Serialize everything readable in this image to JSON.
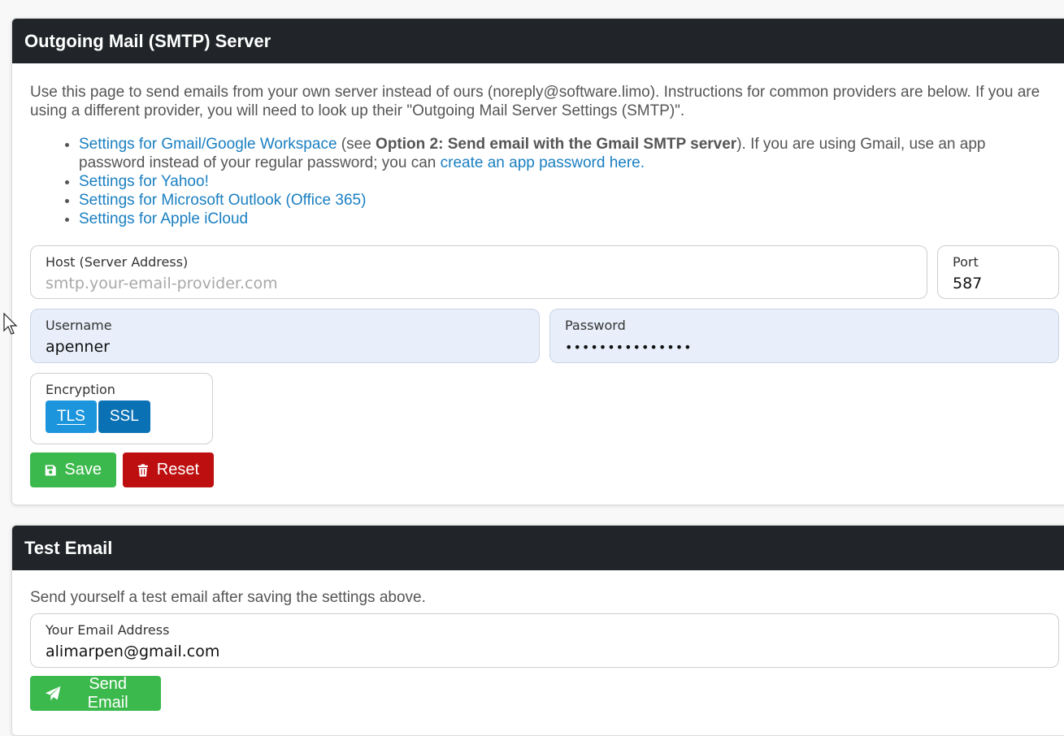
{
  "smtp": {
    "title": "Outgoing Mail (SMTP) Server",
    "intro": "Use this page to send emails from your own server instead of ours (noreply@software.limo). Instructions for common providers are below. If you are using a different provider, you will need to look up their \"Outgoing Mail Server Settings (SMTP)\".",
    "links": {
      "gmail_link": "Settings for Gmail/Google Workspace",
      "gmail_see": " (see ",
      "gmail_option": "Option 2: Send email with the Gmail SMTP server",
      "gmail_rest": "). If you are using Gmail, use an app password instead of your regular password; you can ",
      "app_password_link": "create an app password here.",
      "yahoo_link": "Settings for Yahoo!",
      "outlook_link": "Settings for Microsoft Outlook (Office 365)",
      "icloud_link": "Settings for Apple iCloud"
    },
    "host": {
      "label": "Host (Server Address)",
      "placeholder": "smtp.your-email-provider.com",
      "value": ""
    },
    "port": {
      "label": "Port",
      "value": "587"
    },
    "username": {
      "label": "Username",
      "value": "apenner"
    },
    "password": {
      "label": "Password",
      "value": "•••••••••••••••"
    },
    "encryption": {
      "label": "Encryption",
      "options": [
        "TLS",
        "SSL"
      ],
      "selected": "TLS"
    },
    "save_label": "Save",
    "reset_label": "Reset"
  },
  "test": {
    "title": "Test Email",
    "description": "Send yourself a test email after saving the settings above.",
    "email": {
      "label": "Your Email Address",
      "value": "alimarpen@gmail.com"
    },
    "send_label": "Send Email"
  },
  "colors": {
    "header_bg": "#212529",
    "link": "#1a7fc1",
    "save_green": "#3cb94c",
    "reset_red": "#bd0f0f",
    "tls_active": "#1c95dd",
    "ssl_inactive": "#0b71b5",
    "autofill_bg": "#e8effa"
  },
  "icons": {
    "save": "floppy-disk-icon",
    "reset": "trash-icon",
    "send": "paper-plane-icon"
  }
}
